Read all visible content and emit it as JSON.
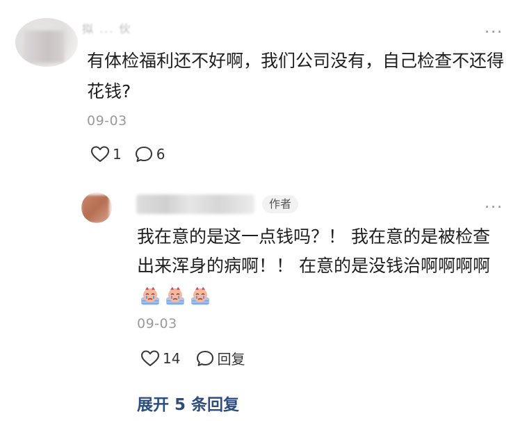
{
  "comment": {
    "username": "拟 ... 伙",
    "text": "有体检福利还不好啊，我们公司没有，自己检查不还得花钱?",
    "date": "09-03",
    "like_count": "1",
    "reply_count": "6",
    "more_label": "..."
  },
  "reply": {
    "author_badge": "作者",
    "text": "我在意的是这一点钱吗？！ 我在意的是被检查出来浑身的病啊！！ 在意的是没钱治啊啊啊啊",
    "date": "09-03",
    "like_count": "14",
    "reply_label": "回复",
    "more_label": "...",
    "emojis": [
      "crying-face-emoji",
      "crying-face-emoji",
      "crying-face-emoji"
    ]
  },
  "expand_label": "展开 5 条回复",
  "colors": {
    "text": "#1e1e1e",
    "muted": "#9a9a9a",
    "link": "#2d4d7e",
    "badge_bg": "#f2f2f2"
  }
}
